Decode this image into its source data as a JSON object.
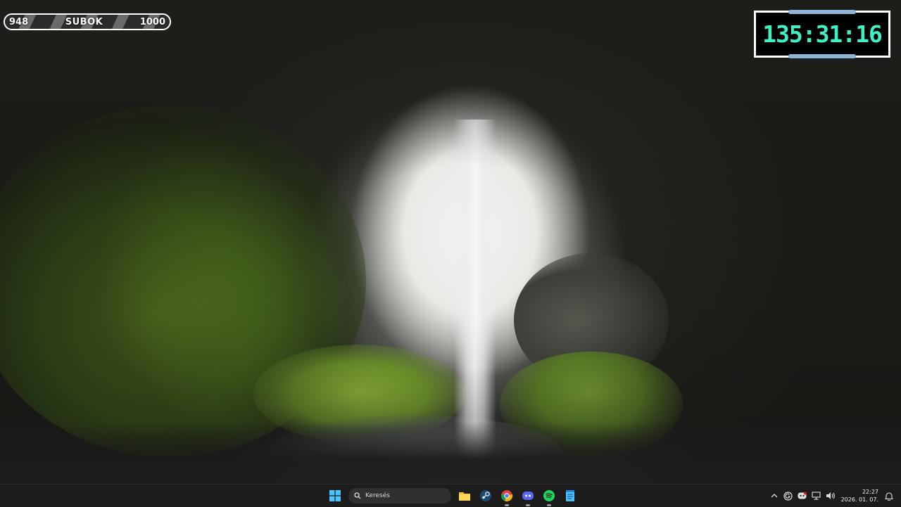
{
  "sub_goal": {
    "current": "948",
    "label": "SUBOK",
    "target": "1000"
  },
  "timer": {
    "value": "135:31:16"
  },
  "taskbar": {
    "search_placeholder": "Keresés",
    "apps": [
      "start-icon",
      "file-explorer-icon",
      "steam-icon",
      "chrome-icon",
      "discord-icon",
      "spotify-icon",
      "notepad-icon"
    ],
    "tray": {
      "time": "22:27",
      "date": "2026. 01. 07."
    }
  },
  "colors": {
    "timer_digits": "#3ff0c5",
    "timer_accent": "#8fb3d6",
    "taskbar": "#1c1c1c"
  }
}
